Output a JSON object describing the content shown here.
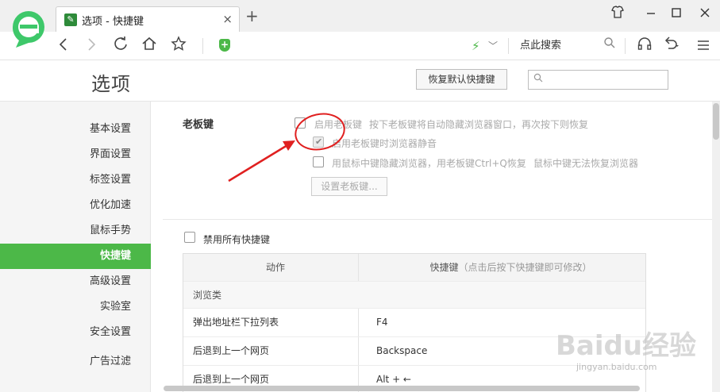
{
  "browser": {
    "tab_title": "选项 - 快捷键",
    "search_hint": "点此搜索"
  },
  "page": {
    "title": "选项",
    "restore_button": "恢复默认快捷键",
    "search_placeholder": ""
  },
  "sidebar": {
    "items": [
      {
        "label": "基本设置"
      },
      {
        "label": "界面设置"
      },
      {
        "label": "标签设置"
      },
      {
        "label": "优化加速"
      },
      {
        "label": "鼠标手势"
      },
      {
        "label": "快捷键"
      },
      {
        "label": "高级设置"
      },
      {
        "label": "实验室"
      },
      {
        "label": "安全设置"
      },
      {
        "label": "广告过滤"
      }
    ],
    "active_index": 5,
    "accent_color": "#4cb848"
  },
  "boss_key": {
    "section_label": "老板键",
    "enable_label": "启用老板键",
    "enable_desc": "按下老板键将自动隐藏浏览器窗口，再次按下则恢复",
    "enable_checked": false,
    "mute_label": "启用老板键时浏览器静音",
    "mute_checked": true,
    "middle_click_label": "用鼠标中键隐藏浏览器，用老板键Ctrl+Q恢复",
    "middle_click_note": "鼠标中键无法恢复浏览器",
    "middle_click_checked": false,
    "set_button": "设置老板键..."
  },
  "shortcuts": {
    "disable_all_label": "禁用所有快捷键",
    "disable_all_checked": false,
    "header_action": "动作",
    "header_shortcut": "快捷键",
    "header_shortcut_hint": "（点击后按下快捷键即可修改）",
    "category": "浏览类",
    "rows": [
      {
        "action": "弹出地址栏下拉列表",
        "key": "F4"
      },
      {
        "action": "后退到上一个网页",
        "key": "Backspace"
      },
      {
        "action": "后退到上一个网页",
        "key": "Alt + ←"
      }
    ]
  },
  "watermark": {
    "brand": "Baidu经验",
    "url": "jingyan.baidu.com"
  },
  "icons": {
    "logo": "360-browser-logo-icon",
    "annotation_color": "#e02020"
  }
}
